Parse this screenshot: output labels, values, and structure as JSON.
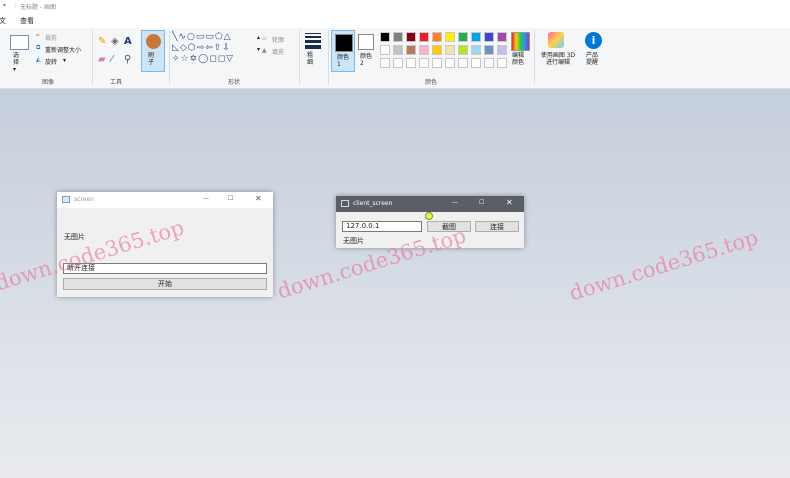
{
  "app": {
    "title": "无标题 - 画图",
    "menu_left": "文",
    "tab_view": "查看"
  },
  "ribbon": {
    "groups": [
      "图像",
      "工具",
      "形状",
      "颜色"
    ],
    "image": {
      "select": "选择",
      "crop": "裁剪",
      "resize": "重新调整大小",
      "rotate": "旋转"
    },
    "tools": {
      "brush": "刷子"
    },
    "shapes": {
      "outline": "轮廓",
      "fill": "填充"
    },
    "size": "粗细",
    "color1": "颜色 1",
    "color2": "颜色 2",
    "edit_colors": "编辑颜色",
    "paint3d": "使用画图 3D 进行编辑",
    "product_alert": "产品提醒",
    "palette": [
      "#000000",
      "#7f7f7f",
      "#880015",
      "#ed1c24",
      "#ff7f27",
      "#fff200",
      "#22b14c",
      "#00a2e8",
      "#3f48cc",
      "#a349a4",
      "#ffffff",
      "#c3c3c3",
      "#b97a57",
      "#ffaec9",
      "#ffc90e",
      "#efe4b0",
      "#b5e61d",
      "#99d9ea",
      "#7092be",
      "#c8bfe7"
    ]
  },
  "screen_window": {
    "title": "screen",
    "status": "无图片",
    "input_value": "断开连接",
    "start_button": "开始"
  },
  "client_window": {
    "title": "client_screen",
    "ip_value": "127.0.0.1",
    "screenshot_button": "截图",
    "connect_button": "连接",
    "status": "无图片"
  },
  "watermark": "down.code365.top",
  "colors": {
    "accent": "#0078d7",
    "client_titlebar": "#5a5f66"
  }
}
